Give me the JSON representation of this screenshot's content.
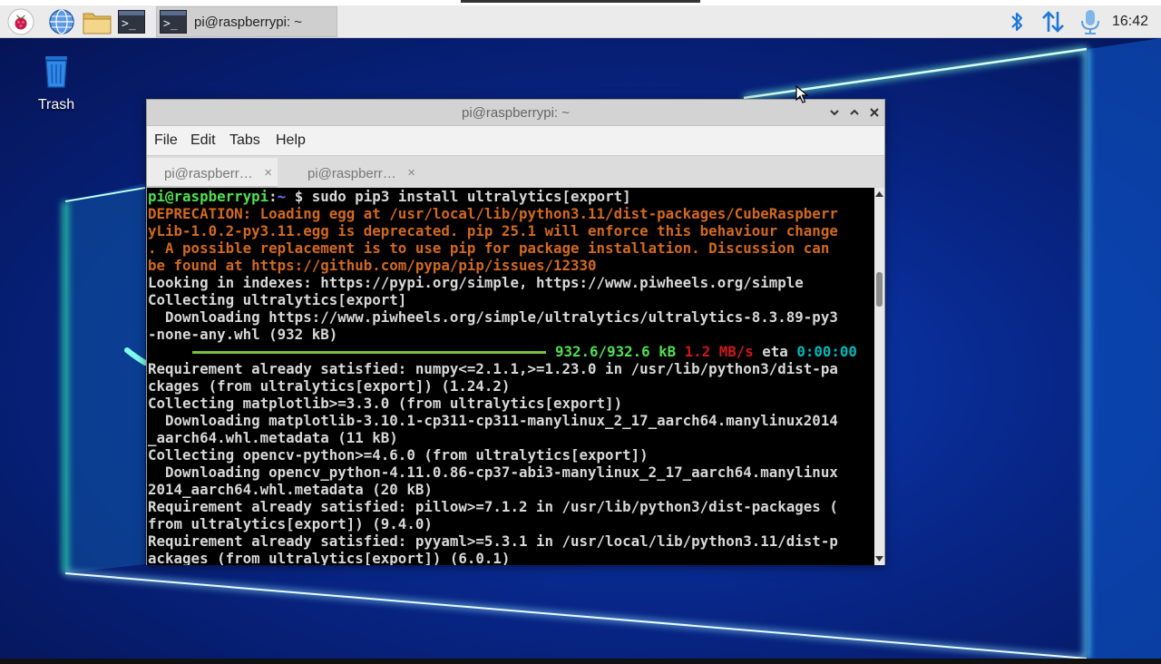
{
  "panel": {
    "icons": [
      "raspberry-menu-icon",
      "web-browser-icon",
      "file-manager-icon",
      "terminal-launcher-icon"
    ],
    "task_button_label": "pi@raspberrypi: ~",
    "tray_icons": [
      "bluetooth-icon",
      "network-icon",
      "microphone-icon"
    ],
    "clock": "16:42"
  },
  "desktop": {
    "trash_label": "Trash"
  },
  "window": {
    "title": "pi@raspberrypi: ~",
    "menu": [
      "File",
      "Edit",
      "Tabs",
      "Help"
    ],
    "tabs": [
      {
        "label": "pi@raspberr…",
        "close": "×"
      },
      {
        "label": "pi@raspberr…",
        "close": "×"
      }
    ]
  },
  "terminal": {
    "prompt_user": "pi@raspberrypi",
    "prompt_sep": ":",
    "prompt_path": "~",
    "prompt_dollar": " $ ",
    "command": "sudo pip3 install ultralytics[export]",
    "deprecation": [
      "DEPRECATION: Loading egg at /usr/local/lib/python3.11/dist-packages/CubeRaspberr",
      "yLib-1.0.2-py3.11.egg is deprecated. pip 25.1 will enforce this behaviour change",
      ". A possible replacement is to use pip for package installation. Discussion can",
      "be found at https://github.com/pypa/pip/issues/12330"
    ],
    "lines_a": [
      "Looking in indexes: https://pypi.org/simple, https://www.piwheels.org/simple",
      "Collecting ultralytics[export]",
      "  Downloading https://www.piwheels.org/simple/ultralytics/ultralytics-8.3.89-py3",
      "-none-any.whl (932 kB)"
    ],
    "progress": {
      "fraction": 1.0,
      "size": "932.6/932.6 kB",
      "speed": "1.2 MB/s",
      "eta_label": "eta",
      "eta": "0:00:00"
    },
    "lines_b": [
      "Requirement already satisfied: numpy<=2.1.1,>=1.23.0 in /usr/lib/python3/dist-pa",
      "ckages (from ultralytics[export]) (1.24.2)",
      "Collecting matplotlib>=3.3.0 (from ultralytics[export])",
      "  Downloading matplotlib-3.10.1-cp311-cp311-manylinux_2_17_aarch64.manylinux2014",
      "_aarch64.whl.metadata (11 kB)",
      "Collecting opencv-python>=4.6.0 (from ultralytics[export])",
      "  Downloading opencv_python-4.11.0.86-cp37-abi3-manylinux_2_17_aarch64.manylinux",
      "2014_aarch64.whl.metadata (20 kB)",
      "Requirement already satisfied: pillow>=7.1.2 in /usr/lib/python3/dist-packages (",
      "from ultralytics[export]) (9.4.0)",
      "Requirement already satisfied: pyyaml>=5.3.1 in /usr/local/lib/python3.11/dist-p",
      "ackages (from ultralytics[export]) (6.0.1)"
    ]
  },
  "colors": {
    "prompt_user": "#4fe04f",
    "prompt_path": "#5b7bff",
    "warning": "#d2691e",
    "speed": "#d01818",
    "eta": "#00b8b8",
    "progress_bar": "#7ac043"
  }
}
